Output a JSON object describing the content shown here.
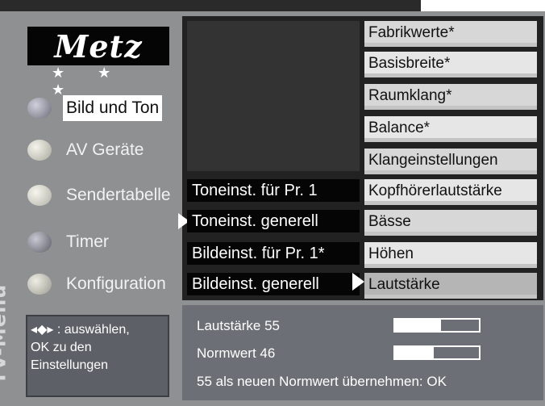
{
  "logo": {
    "brand": "Metz",
    "stars": "★ ★ ★"
  },
  "menu_title": "TV-Menü",
  "nav": [
    {
      "label": "Bild und Ton",
      "active": true,
      "bullet_color": "#9a9aa6"
    },
    {
      "label": "AV Geräte",
      "active": false,
      "bullet_color": "#d2d2c8"
    },
    {
      "label": "Sendertabelle",
      "active": false,
      "bullet_color": "#d9d9cf"
    },
    {
      "label": "Timer",
      "active": false,
      "bullet_color": "#8e8e98"
    },
    {
      "label": "Konfiguration",
      "active": false,
      "bullet_color": "#c8c8c0"
    }
  ],
  "submenu": [
    {
      "label": "Toneinst. für Pr. 1",
      "selected": false
    },
    {
      "label": "Toneinst. generell",
      "selected": true
    },
    {
      "label": "Bildeinst. für Pr. 1*",
      "selected": false
    },
    {
      "label": "Bildeinst. generell",
      "selected": false
    }
  ],
  "options": [
    {
      "label": "Fabrikwerte*",
      "selected": false
    },
    {
      "label": "Basisbreite*",
      "selected": false
    },
    {
      "label": "Raumklang*",
      "selected": false
    },
    {
      "label": "Balance*",
      "selected": false
    },
    {
      "label": "Klangeinstellungen",
      "selected": false
    },
    {
      "label": "Kopfhörerlautstärke",
      "selected": false
    },
    {
      "label": "Bässe",
      "selected": false
    },
    {
      "label": "Höhen",
      "selected": false
    },
    {
      "label": "Lautstärke",
      "selected": true
    }
  ],
  "help": {
    "line1": ": auswählen,",
    "arrows": "◂◆▸",
    "line2": "OK zu den",
    "line3": "Einstellungen"
  },
  "info": {
    "volume_label": "Lautstärke 55",
    "volume_value": 55,
    "norm_label": "Normwert 46",
    "norm_value": 46,
    "confirm_text": "55 als neuen Normwert übernehmen: OK"
  }
}
